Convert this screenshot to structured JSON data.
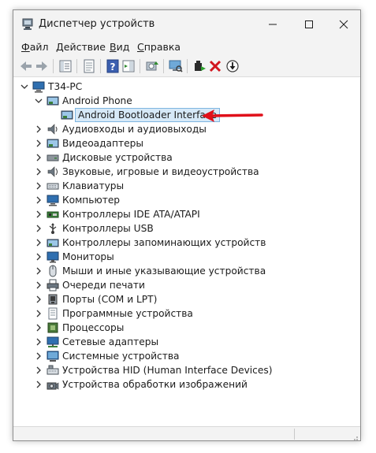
{
  "window": {
    "title": "Диспетчер устройств",
    "controls": {
      "minimize": "minimize",
      "maximize": "maximize",
      "close": "close"
    }
  },
  "menu": [
    {
      "label": "Файл"
    },
    {
      "label": "Действие"
    },
    {
      "label": "Вид"
    },
    {
      "label": "Справка"
    }
  ],
  "toolbar": {
    "buttons": [
      "back-icon",
      "forward-icon",
      "show-hide-tree-icon",
      "properties-icon",
      "help-icon",
      "action-pane-icon",
      "update-driver-icon",
      "scan-hardware-icon",
      "enable-device-icon",
      "uninstall-device-icon",
      "disable-device-icon"
    ]
  },
  "tree": {
    "root": "T34-PC",
    "expanded_category": "Android Phone",
    "selected_device": "Android Bootloader Interface",
    "categories": [
      "Аудиовходы и аудиовыходы",
      "Видеоадаптеры",
      "Дисковые устройства",
      "Звуковые, игровые и видеоустройства",
      "Клавиатуры",
      "Компьютер",
      "Контроллеры IDE ATA/ATAPI",
      "Контроллеры USB",
      "Контроллеры запоминающих устройств",
      "Мониторы",
      "Мыши и иные указывающие устройства",
      "Очереди печати",
      "Порты (COM и LPT)",
      "Программные устройства",
      "Процессоры",
      "Сетевые адаптеры",
      "Системные устройства",
      "Устройства HID (Human Interface Devices)",
      "Устройства обработки изображений"
    ]
  },
  "colors": {
    "accent_arrow": "#e0101a",
    "selection": "#d6e9f8",
    "selection_border": "#7fb5e0"
  }
}
